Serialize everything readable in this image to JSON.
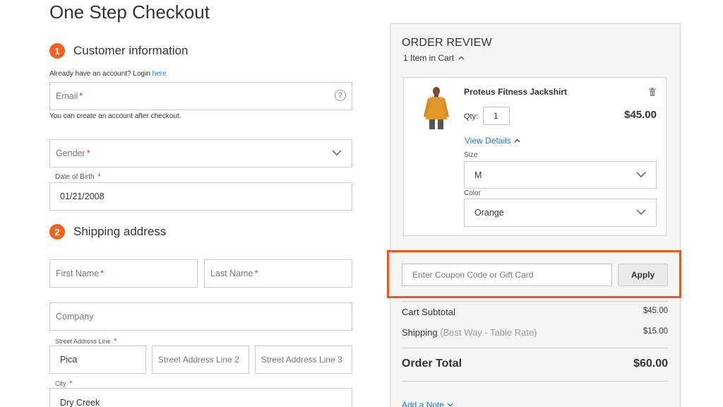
{
  "page_title": "One Step Checkout",
  "customer": {
    "step": "1",
    "title": "Customer information",
    "login_prompt": "Already have an account? Login",
    "login_link": "here",
    "email_placeholder": "Email",
    "email_help": "?",
    "account_note": "You can create an account after checkout.",
    "gender_placeholder": "Gender",
    "dob_label": "Date of Birth",
    "dob_value": "01/21/2008",
    "required_mark": "*"
  },
  "shipping": {
    "step": "2",
    "title": "Shipping address",
    "first_name_placeholder": "First Name",
    "last_name_placeholder": "Last Name",
    "company_placeholder": "Company",
    "street_label": "Street Address Line",
    "street1_value": "Pica",
    "street2_placeholder": "Street Address Line 2",
    "street3_placeholder": "Street Address Line 3",
    "city_label": "City",
    "city_value": "Dry Creek"
  },
  "order_review": {
    "title": "ORDER REVIEW",
    "items_in_cart": "1 Item in Cart",
    "item": {
      "name": "Proteus Fitness Jackshirt",
      "qty_label": "Qty:",
      "qty_value": "1",
      "price": "$45.00",
      "view_details": "View Details",
      "size_label": "Size",
      "size_value": "M",
      "color_label": "Color",
      "color_value": "Orange"
    },
    "coupon_placeholder": "Enter Coupon Code or Gift Card",
    "apply_label": "Apply",
    "cart_subtotal_label": "Cart Subtotal",
    "cart_subtotal_value": "$45.00",
    "shipping_label": "Shipping",
    "shipping_method": "(Best Way - Table Rate)",
    "shipping_value": "$15.00",
    "order_total_label": "Order Total",
    "order_total_value": "$60.00",
    "add_note": "Add a Note"
  },
  "colors": {
    "accent": "#f26322",
    "link": "#1979c3",
    "highlight": "#e8591b",
    "required": "#e02b27"
  },
  "icons": {
    "help": "question-circle-icon",
    "dropdown": "chevron-down-icon",
    "collapse": "chevron-up-icon",
    "delete": "trash-icon"
  }
}
